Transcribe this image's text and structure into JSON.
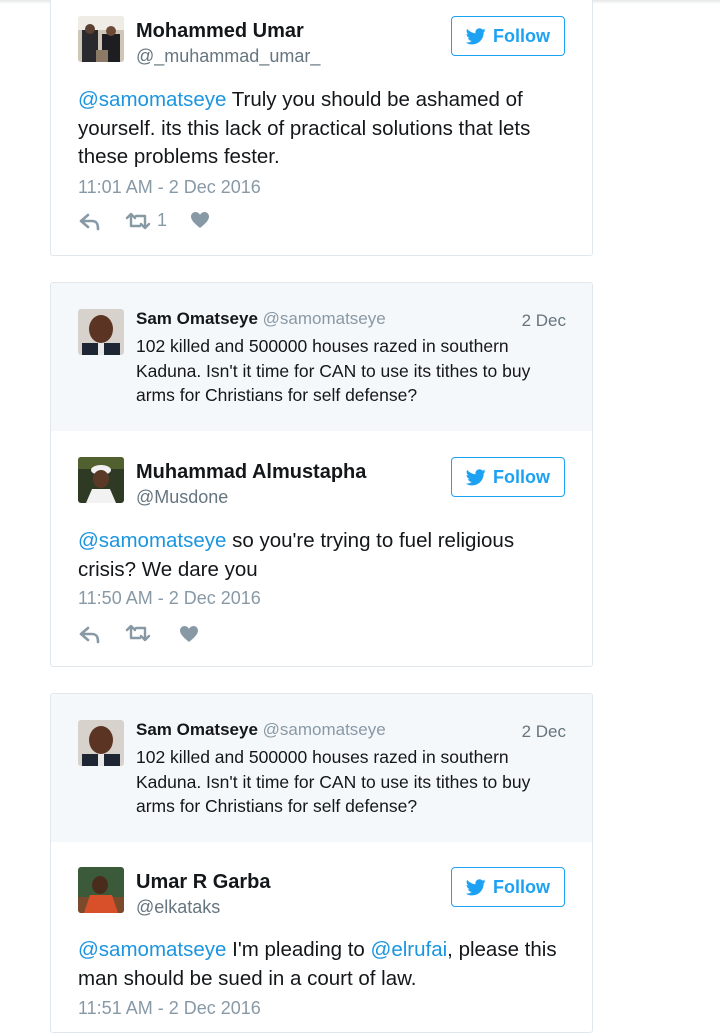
{
  "tweets": [
    {
      "name": "Mohammed Umar",
      "handle": "@_muhammad_umar_",
      "follow_label": "Follow",
      "mention": "@samomatseye",
      "text": " Truly you should be ashamed of yourself. its this lack of practical solutions that lets these problems fester.",
      "timestamp": "11:01 AM - 2 Dec 2016",
      "retweet_count": "1"
    },
    {
      "quoted": {
        "name": "Sam Omatseye",
        "handle": "@samomatseye",
        "date": "2 Dec",
        "text": "102 killed and 500000 houses razed in southern Kaduna. Isn't it time for CAN to use its tithes to buy arms for Christians for self defense?"
      },
      "name": "Muhammad Almustapha",
      "handle": "@Musdone",
      "follow_label": "Follow",
      "mention": "@samomatseye",
      "text": " so you're trying to fuel religious crisis? We dare you",
      "timestamp": "11:50 AM - 2 Dec 2016"
    },
    {
      "quoted": {
        "name": "Sam Omatseye",
        "handle": "@samomatseye",
        "date": "2 Dec",
        "text": "102 killed and 500000 houses razed in southern Kaduna. Isn't it time for CAN to use its tithes to buy arms for Christians for self defense?"
      },
      "name": "Umar R Garba",
      "handle": "@elkataks",
      "follow_label": "Follow",
      "mention": "@samomatseye",
      "text_a": " I'm pleading to ",
      "mention2": "@elrufai",
      "text_b": ", please this man should be sued in a court of law.",
      "timestamp": "11:51 AM - 2 Dec 2016"
    }
  ],
  "colors": {
    "accent": "#1da1f2",
    "mention": "#1b95e0",
    "muted": "#8899a6",
    "border": "#e1e8ed",
    "quoted_bg": "#f5f8fa"
  },
  "icons": [
    "twitter-bird-icon",
    "reply-icon",
    "retweet-icon",
    "like-heart-icon"
  ]
}
